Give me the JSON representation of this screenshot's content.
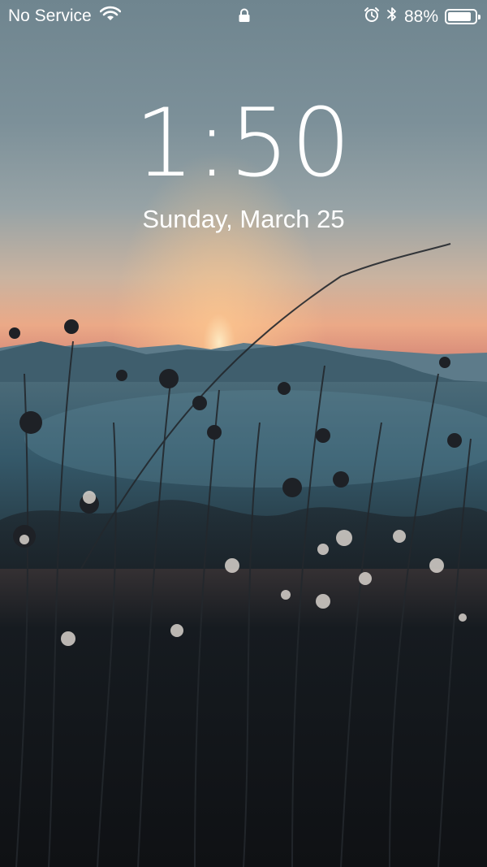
{
  "status_bar": {
    "carrier": "No Service",
    "wifi_icon": "wifi-icon",
    "lock_icon": "lock-icon",
    "alarm_icon": "alarm-clock-icon",
    "bluetooth_icon": "bluetooth-icon",
    "battery_percent_text": "88%",
    "battery_level": 0.88,
    "battery_icon": "battery-icon"
  },
  "lock_screen": {
    "time": "1:50",
    "date": "Sunday, March 25"
  },
  "colors": {
    "text": "#ffffff",
    "sky_top": "#7a8d96",
    "sunset_glow": "#e8a77d",
    "mountains": "#3c5664",
    "foreground": "#17191c"
  }
}
